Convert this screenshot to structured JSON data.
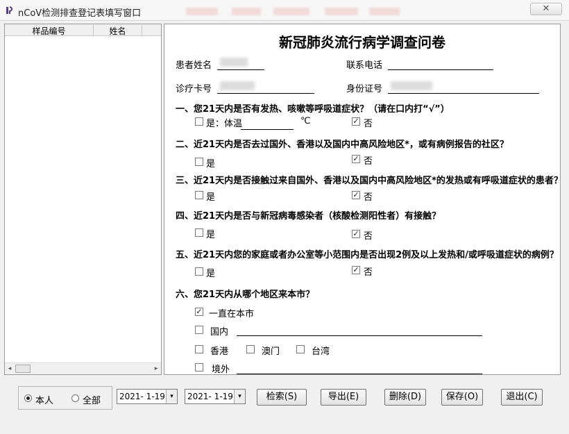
{
  "window": {
    "title": "nCoV检测排查登记表填写窗口",
    "close_symbol": "✕"
  },
  "left_panel": {
    "columns": [
      "样品编号",
      "姓名"
    ],
    "scroll_left": "◂",
    "scroll_right": "▸"
  },
  "form": {
    "title": "新冠肺炎流行病学调查问卷",
    "fields": {
      "patient_name_label": "患者姓名",
      "phone_label": "联系电话",
      "card_label": "诊疗卡号",
      "id_label": "身份证号"
    },
    "questions": [
      {
        "text": "一、您21天内是否有发热、咳嗽等呼吸道症状？（请在口内打“√”）",
        "yes_label": "是：体温",
        "unit": "℃",
        "no_label": "否",
        "yes_checked": false,
        "no_checked": true
      },
      {
        "text": "二、近21天内是否去过国外、香港以及国内中高风险地区*，或有病例报告的社区？",
        "yes_label": "是",
        "no_label": "否",
        "yes_checked": false,
        "no_checked": true
      },
      {
        "text": "三、近21天内是否接触过来自国外、香港以及国内中高风险地区*的发热或有呼吸道症状的患者？",
        "yes_label": "是",
        "no_label": "否",
        "yes_checked": false,
        "no_checked": true
      },
      {
        "text": "四、近21天内是否与新冠病毒感染者（核酸检测阳性者）有接触？",
        "yes_label": "是",
        "no_label": "否",
        "yes_checked": false,
        "no_checked": true
      },
      {
        "text": "五、近21天内您的家庭或者办公室等小范围内是否出现2例及以上发热和/或呼吸道症状的病例？",
        "yes_label": "是",
        "no_label": "否",
        "yes_checked": false,
        "no_checked": true
      }
    ],
    "q6": {
      "text": "六、您21天内从哪个地区来本市？",
      "options": {
        "local": "一直在本市",
        "domestic": "国内",
        "hongkong": "香港",
        "macau": "澳门",
        "taiwan": "台湾",
        "abroad": "境外"
      },
      "local_checked": true
    },
    "check_mark": "✓"
  },
  "bottom": {
    "radio_self": "本人",
    "radio_all": "全部",
    "radio_selected": "self",
    "date_from": "2021- 1-19",
    "date_to": "2021- 1-19",
    "dropdown_symbol": "▾",
    "buttons": {
      "search": "检索(S)",
      "export": "导出(E)",
      "delete": "删除(D)",
      "save": "保存(O)",
      "exit": "退出(C)"
    }
  },
  "colors": {
    "window_bg": "#f0f0f0",
    "panel_bg": "#ffffff",
    "border": "#9a9a9a"
  }
}
